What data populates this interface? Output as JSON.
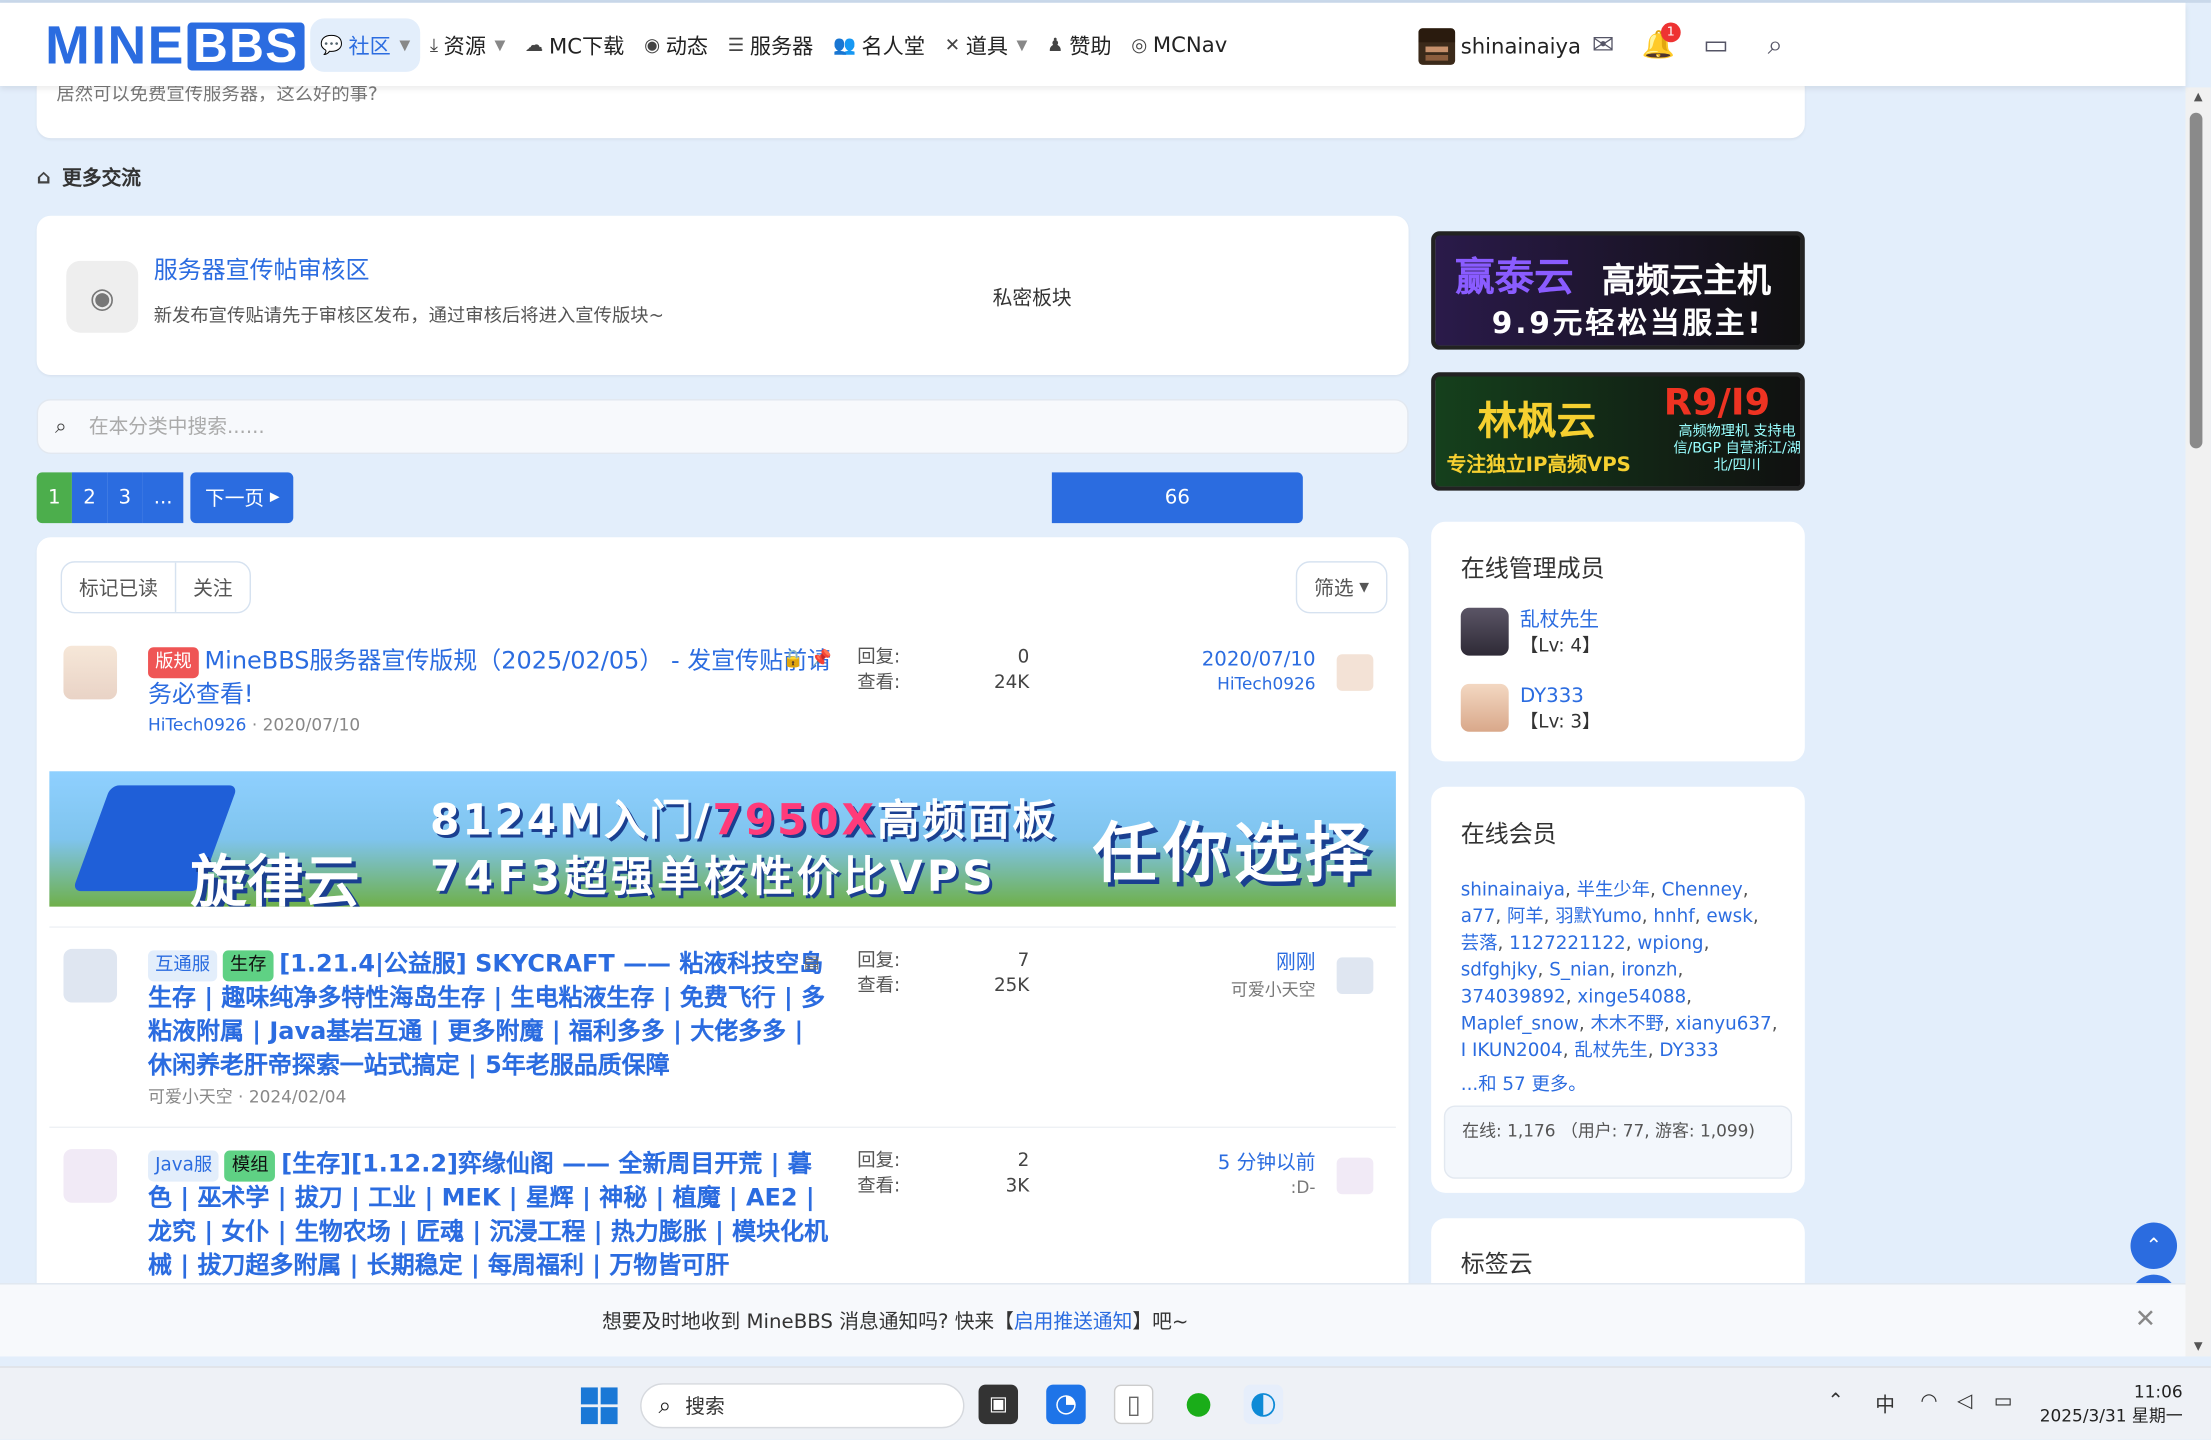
{
  "header": {
    "logo_left": "MINE",
    "logo_right": "BBS",
    "nav": [
      {
        "label": "社区",
        "icon": "chat-icon",
        "caret": true,
        "active": true
      },
      {
        "label": "资源",
        "icon": "download-icon",
        "caret": true
      },
      {
        "label": "MC下载",
        "icon": "cloud-icon"
      },
      {
        "label": "动态",
        "icon": "broadcast-icon"
      },
      {
        "label": "服务器",
        "icon": "server-icon"
      },
      {
        "label": "名人堂",
        "icon": "users-icon"
      },
      {
        "label": "道具",
        "icon": "tools-icon",
        "caret": true
      },
      {
        "label": "赞助",
        "icon": "sponsor-icon"
      },
      {
        "label": "MCNav",
        "icon": "compass-icon"
      }
    ],
    "username": "shinainaiya",
    "notification_count": "1"
  },
  "top_card_text": "居然可以免费宣传服务器，这么好的事?",
  "section_title": "更多交流",
  "forum": {
    "title": "服务器宣传帖审核区",
    "description": "新发布宣传贴请先于审核区发布，通过审核后将进入宣传版块~",
    "status": "私密板块"
  },
  "search": {
    "placeholder": "在本分类中搜索......"
  },
  "pagination": {
    "pages": [
      "1",
      "2",
      "3",
      "...",
      "66"
    ],
    "next": "下一页"
  },
  "list_controls": {
    "mark_read": "标记已读",
    "watch": "关注",
    "filter": "筛选"
  },
  "threads": [
    {
      "tags": [
        {
          "text": "版规",
          "style": "red"
        }
      ],
      "title": "MineBBS服务器宣传版规（2025/02/05） - 发宣传贴前请务必查看!",
      "author": "HiTech0926",
      "date": "2020/07/10",
      "replies_label": "回复:",
      "replies": "0",
      "views_label": "查看:",
      "views": "24K",
      "last_date": "2020/07/10",
      "last_user": "HiTech0926"
    },
    {
      "tags": [
        {
          "text": "互通服",
          "style": "blue"
        },
        {
          "text": "生存",
          "style": "green"
        }
      ],
      "title": "[1.21.4|公益服] SKYCRAFT —— 粘液科技空岛生存 | 趣味纯净多特性海岛生存 | 生电粘液生存 | 免费飞行 | 多粘液附属 | Java基岩互通 | 更多附魔 | 福利多多 | 大佬多多 | 休闲养老肝帝探索一站式搞定 | 5年老服品质保障",
      "author": "可爱小天空",
      "date": "2024/02/04",
      "replies_label": "回复:",
      "replies": "7",
      "views_label": "查看:",
      "views": "25K",
      "last_date": "刚刚",
      "last_user": "可爱小天空"
    },
    {
      "tags": [
        {
          "text": "Java服",
          "style": "blue"
        },
        {
          "text": "模组",
          "style": "green"
        }
      ],
      "title": "[生存][1.12.2]弈缘仙阁 —— 全新周目开荒 | 暮色 | 巫术学 | 拔刀 | 工业 | MEK | 星辉 | 神秘 | 植魔 | AE2 | 龙究 | 女仆 | 生物农场 | 匠魂 | 沉浸工程 | 热力膨胀 | 模块化机械 | 拔刀超多附属 | 长期稳定 | 每周福利 | 万物皆可肝",
      "author": "",
      "date": "",
      "replies_label": "回复:",
      "replies": "2",
      "views_label": "查看:",
      "views": "3K",
      "last_date": "5 分钟以前",
      "last_user": ":D-"
    }
  ],
  "banner": {
    "line1_a": "8124M入门/",
    "line1_b": "7950X",
    "line1_c": "高频面板",
    "line2": "74F3超强单核性价比VPS",
    "brand": "旋律云",
    "slogan": "任你选择"
  },
  "ads": [
    {
      "brand": "赢泰云",
      "tagline": "高频云主机",
      "sub": "9.9元轻松当服主!"
    },
    {
      "brand": "林枫云",
      "model": "R9/I9",
      "sub": "专注独立IP高频VPS",
      "detail": "高频物理机 支持电信/BGP 自营浙江/湖北/四川"
    }
  ],
  "staff": {
    "title": "在线管理成员",
    "members": [
      {
        "name": "乱杖先生",
        "level": "【Lv: 4】"
      },
      {
        "name": "DY333",
        "level": "【Lv: 3】"
      }
    ]
  },
  "online_members": {
    "title": "在线会员",
    "names": [
      "shinainaiya",
      "半生少年",
      "Chenney",
      "a77",
      "阿羊",
      "羽默Yumo",
      "hnhf",
      "ewsk",
      "芸落",
      "1127221122",
      "wpiong",
      "sdfghjky",
      "S_nian",
      "ironzh",
      "374039892",
      "xinge54088",
      "Maplef_snow",
      "木木不野",
      "xianyu637",
      "I IKUN2004",
      "乱杖先生",
      "DY333"
    ],
    "more": "...和 57 更多。",
    "stats": "在线: 1,176 （用户: 77, 游客: 1,099)"
  },
  "tags_card_title": "标签云",
  "notice": {
    "prefix": "想要及时地收到 MineBBS 消息通知吗? 快来【",
    "link": "启用推送通知",
    "suffix": "】吧~"
  },
  "taskbar": {
    "search_placeholder": "搜索",
    "tray_ime": "中",
    "time": "11:06",
    "date": "2025/3/31 星期一"
  },
  "colors": {
    "accent": "#2b6ce0",
    "page_bg": "#e3eefb",
    "current_page": "#4cae4c",
    "rule_tag": "#ef5555"
  }
}
